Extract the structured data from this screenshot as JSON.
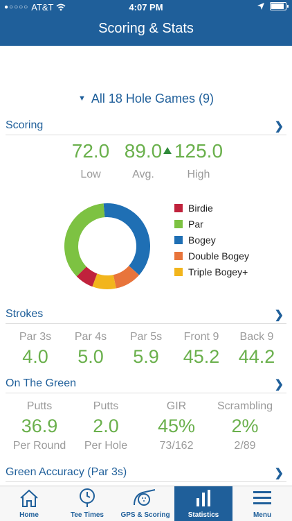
{
  "status": {
    "carrier": "AT&T",
    "time": "4:07 PM"
  },
  "header": {
    "title": "Scoring & Stats"
  },
  "filter": {
    "label": "All 18 Hole Games (9)"
  },
  "scoring": {
    "title": "Scoring",
    "low": "72.0",
    "low_label": "Low",
    "avg": "89.0",
    "avg_label": "Avg.",
    "high": "125.0",
    "high_label": "High"
  },
  "chart_data": {
    "type": "pie",
    "categories": [
      "Birdie",
      "Par",
      "Bogey",
      "Double Bogey",
      "Triple Bogey+"
    ],
    "values": [
      7,
      36,
      38,
      10,
      9
    ],
    "colors": [
      "#c0223c",
      "#7dc242",
      "#1f6fb4",
      "#e8743b",
      "#f2b51c"
    ],
    "legend_position": "right"
  },
  "strokes": {
    "title": "Strokes",
    "items": [
      {
        "label": "Par 3s",
        "value": "4.0"
      },
      {
        "label": "Par 4s",
        "value": "5.0"
      },
      {
        "label": "Par 5s",
        "value": "5.9"
      },
      {
        "label": "Front 9",
        "value": "45.2"
      },
      {
        "label": "Back 9",
        "value": "44.2"
      }
    ]
  },
  "green": {
    "title": "On The Green",
    "items": [
      {
        "label": "Putts",
        "value": "36.9",
        "sub": "Per Round"
      },
      {
        "label": "Putts",
        "value": "2.0",
        "sub": "Per Hole"
      },
      {
        "label": "GIR",
        "value": "45%",
        "sub": "73/162"
      },
      {
        "label": "Scrambling",
        "value": "2%",
        "sub": "2/89"
      }
    ]
  },
  "accuracy": {
    "title": "Green Accuracy (Par 3s)"
  },
  "tabs": [
    {
      "label": "Home",
      "icon": "home-icon"
    },
    {
      "label": "Tee Times",
      "icon": "clock-icon"
    },
    {
      "label": "GPS & Scoring",
      "icon": "golf-ball-icon"
    },
    {
      "label": "Statistics",
      "icon": "bar-chart-icon"
    },
    {
      "label": "Menu",
      "icon": "menu-icon"
    }
  ]
}
